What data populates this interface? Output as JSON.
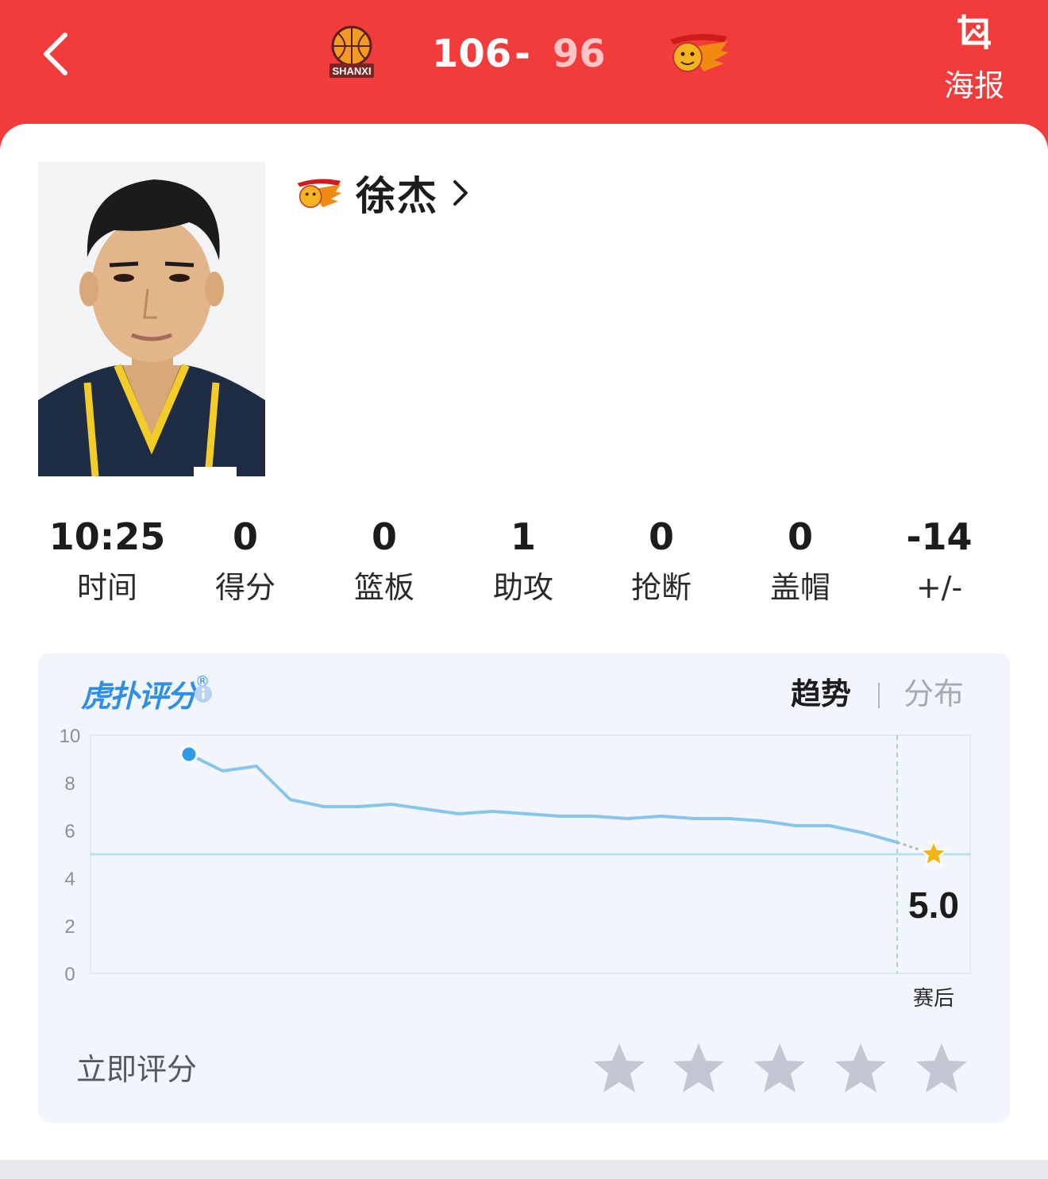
{
  "header": {
    "home_score": "106",
    "separator": "-",
    "away_score": "96",
    "poster_label": "海报",
    "home_logo_text": "SHANXI",
    "colors": {
      "background": "#f23c3c",
      "away_score": "#ffc5c5"
    },
    "icons": {
      "back": "chevron-left-icon",
      "poster": "poster-image-icon"
    }
  },
  "player": {
    "name": "徐杰",
    "team_icon": "guangdong-tigers-logo",
    "photo": "player-headshot"
  },
  "stats": [
    {
      "value": "10:25",
      "label": "时间"
    },
    {
      "value": "0",
      "label": "得分"
    },
    {
      "value": "0",
      "label": "篮板"
    },
    {
      "value": "1",
      "label": "助攻"
    },
    {
      "value": "0",
      "label": "抢断"
    },
    {
      "value": "0",
      "label": "盖帽"
    },
    {
      "value": "-14",
      "label": "+/-"
    }
  ],
  "rating": {
    "logo_text": "虎扑评分",
    "logo_mark": "®",
    "tabs": {
      "trend": "趋势",
      "distribution": "分布",
      "active": "trend"
    },
    "final_label": "赛后",
    "final_score": "5.0",
    "rate_now_label": "立即评分",
    "stars_total": 5,
    "colors": {
      "line": "#87c6ec",
      "start_dot": "#2f9be8",
      "star": "#f6b30e",
      "empty_star": "#c3c7d3"
    }
  },
  "chart_data": {
    "type": "line",
    "ylim": [
      0,
      10
    ],
    "yticks": [
      "0",
      "2",
      "4",
      "6",
      "8",
      "10"
    ],
    "grid": true,
    "series": [
      {
        "values": [
          9.2,
          8.5,
          8.7,
          7.3,
          7.0,
          7.0,
          7.1,
          6.9,
          6.7,
          6.8,
          6.7,
          6.6,
          6.6,
          6.5,
          6.6,
          6.5,
          6.5,
          6.4,
          6.2,
          6.2,
          5.9,
          5.5
        ]
      }
    ],
    "final": {
      "label": "赛后",
      "value": 5.0
    },
    "reference_line": 5.0
  }
}
